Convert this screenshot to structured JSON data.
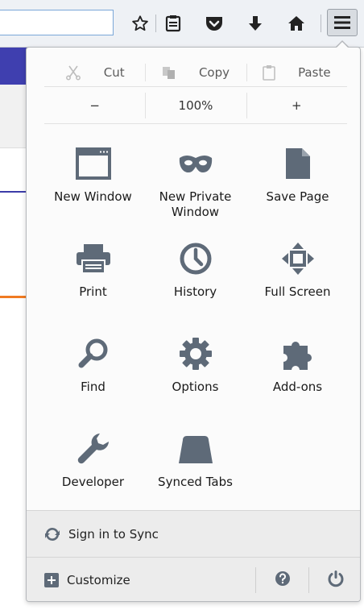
{
  "toolbar": {
    "icons": [
      "star-icon",
      "reading-list-icon",
      "pocket-icon",
      "download-icon",
      "home-icon",
      "hamburger-menu-icon"
    ]
  },
  "edit": {
    "cut": "Cut",
    "copy": "Copy",
    "paste": "Paste"
  },
  "zoom": {
    "minus": "−",
    "level": "100%",
    "plus": "+"
  },
  "items": [
    {
      "label": "New Window",
      "icon": "window-icon"
    },
    {
      "label": "New Private Window",
      "icon": "mask-icon"
    },
    {
      "label": "Save Page",
      "icon": "page-icon"
    },
    {
      "label": "Print",
      "icon": "printer-icon"
    },
    {
      "label": "History",
      "icon": "clock-icon"
    },
    {
      "label": "Full Screen",
      "icon": "fullscreen-icon"
    },
    {
      "label": "Find",
      "icon": "magnifier-icon"
    },
    {
      "label": "Options",
      "icon": "gear-icon"
    },
    {
      "label": "Add-ons",
      "icon": "puzzle-icon"
    },
    {
      "label": "Developer",
      "icon": "wrench-icon"
    },
    {
      "label": "Synced Tabs",
      "icon": "synced-tabs-icon"
    }
  ],
  "footer": {
    "sync": "Sign in to Sync",
    "customize": "Customize"
  },
  "colors": {
    "icon": "#5e6a78",
    "accent_blue": "#3f3faf",
    "accent_orange": "#f07a22"
  }
}
